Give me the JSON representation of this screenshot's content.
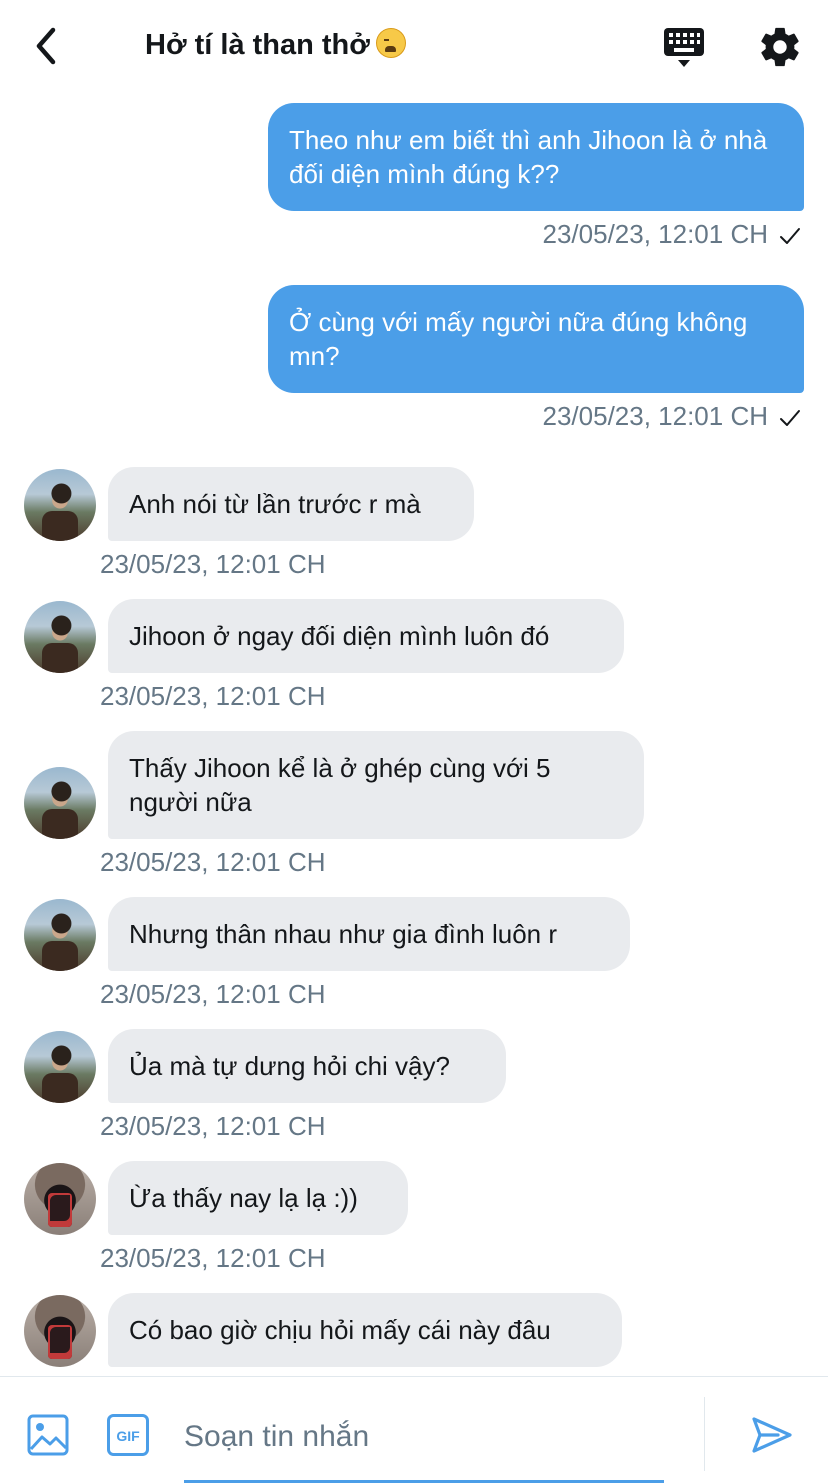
{
  "header": {
    "title": "Hở tí là than thở"
  },
  "messages": [
    {
      "direction": "out",
      "text": "Theo như em biết thì anh Jihoon là ở nhà đối diện mình đúng k??",
      "time": "23/05/23, 12:01 CH"
    },
    {
      "direction": "out",
      "text": "Ở cùng với mấy người nữa đúng không mn?",
      "time": "23/05/23, 12:01 CH"
    },
    {
      "direction": "in",
      "text": "Anh nói từ lần trước r mà",
      "time": "23/05/23, 12:01 CH"
    },
    {
      "direction": "in",
      "text": "Jihoon ở ngay đối diện mình luôn đó",
      "time": "23/05/23, 12:01 CH"
    },
    {
      "direction": "in",
      "text": "Thấy Jihoon kể là ở ghép cùng với 5 người nữa",
      "time": "23/05/23, 12:01 CH"
    },
    {
      "direction": "in",
      "text": "Nhưng thân nhau như gia đình luôn r",
      "time": "23/05/23, 12:01 CH"
    },
    {
      "direction": "in",
      "text": "Ủa mà tự dưng hỏi chi vậy?",
      "time": "23/05/23, 12:01 CH"
    },
    {
      "direction": "in",
      "text": "Ừa thấy nay lạ lạ :))",
      "time": "23/05/23, 12:01 CH"
    },
    {
      "direction": "in",
      "text": "Có bao giờ chịu hỏi mấy cái này đâu",
      "time": ""
    }
  ],
  "composer": {
    "placeholder": "Soạn tin nhắn",
    "gif_label": "GIF"
  },
  "colors": {
    "accent": "#4b9ee8",
    "incoming_bubble": "#e9ebee",
    "timestamp": "#657786"
  },
  "icons": [
    "back-arrow-icon",
    "keyboard-icon",
    "gear-icon",
    "image-icon",
    "gif-icon",
    "send-icon",
    "check-icon"
  ]
}
